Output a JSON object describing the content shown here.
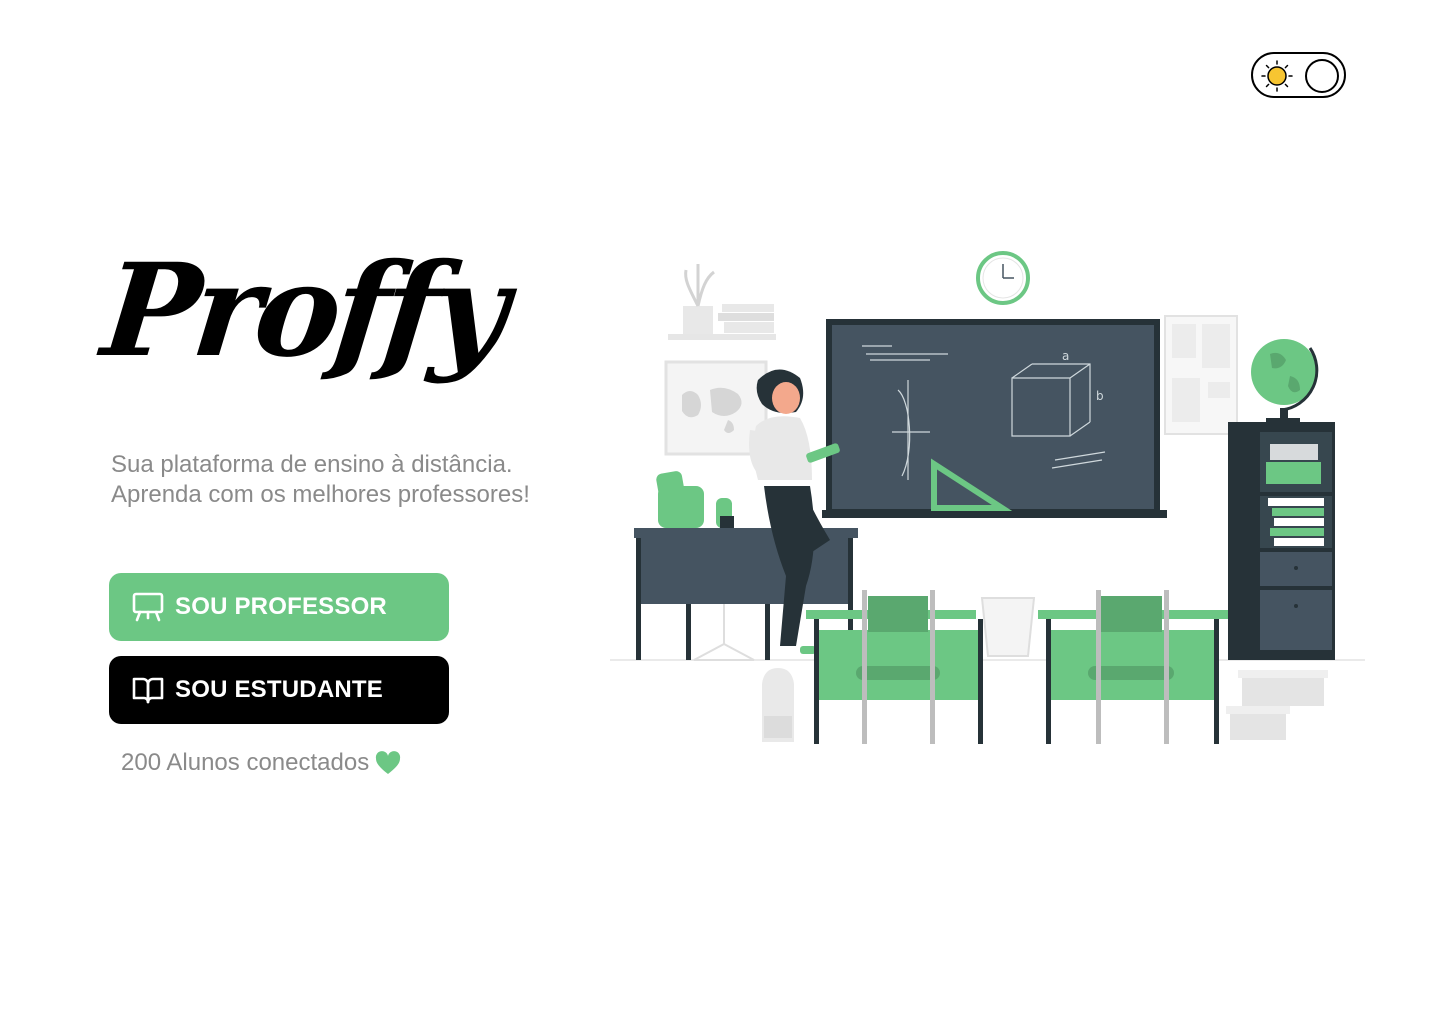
{
  "app": {
    "logo_text": "Proffy"
  },
  "theme_toggle": {
    "mode": "light",
    "sun_color": "#f7c531"
  },
  "hero": {
    "tagline": "Sua plataforma de ensino à distância. Aprenda com os melhores professores!",
    "teacher_button": "SOU PROFESSOR",
    "student_button": "SOU ESTUDANTE",
    "connected_text": "200 Alunos conectados"
  },
  "colors": {
    "accent_green": "#6cc784",
    "dark": "#000000",
    "muted_text": "#8a8a8a",
    "board": "#455461"
  },
  "icons": {
    "teacher_button_icon": "presentation-board-icon",
    "student_button_icon": "open-book-icon",
    "connected_icon": "heart-icon",
    "theme_icon": "sun-icon"
  }
}
